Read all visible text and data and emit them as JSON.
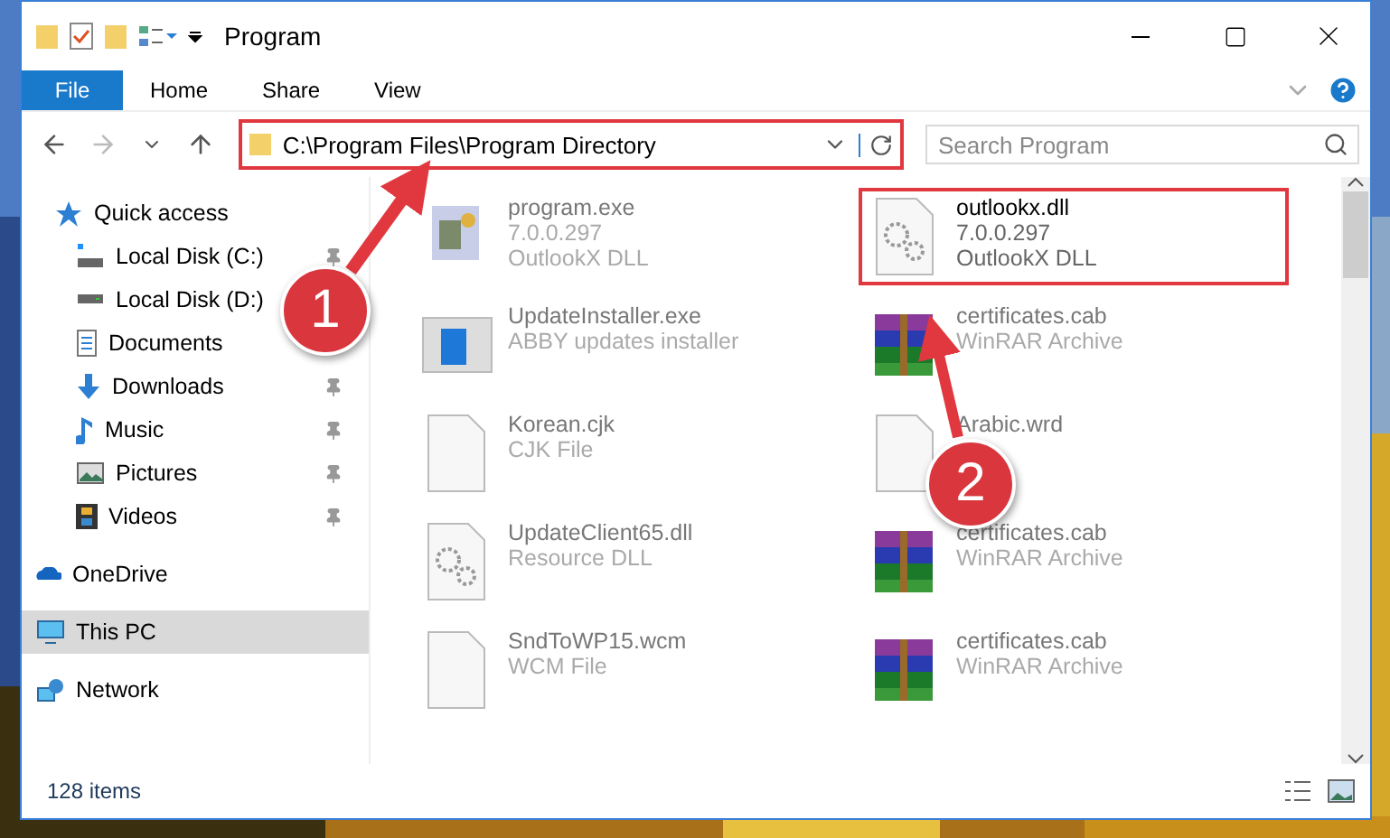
{
  "window": {
    "title": "Program"
  },
  "ribbon": {
    "tabs": [
      {
        "label": "File",
        "kind": "menu"
      },
      {
        "label": "Home",
        "kind": "tab"
      },
      {
        "label": "Share",
        "kind": "tab"
      },
      {
        "label": "View",
        "kind": "tab"
      }
    ]
  },
  "address_bar": {
    "path": "C:\\Program Files\\Program Directory",
    "highlighted": true
  },
  "search": {
    "placeholder": "Search Program"
  },
  "sidebar": {
    "items": [
      {
        "label": "Quick access",
        "selected": false,
        "children": [
          {
            "label": "Local Disk (C:)",
            "pinned": true
          },
          {
            "label": "Local Disk (D:)"
          },
          {
            "label": "Documents"
          },
          {
            "label": "Downloads",
            "pinned": true
          },
          {
            "label": "Music",
            "pinned": true
          },
          {
            "label": "Pictures",
            "pinned": true
          },
          {
            "label": "Videos",
            "pinned": true
          }
        ]
      },
      {
        "label": "OneDrive",
        "selected": false
      },
      {
        "label": "This PC",
        "selected": true
      },
      {
        "label": "Network",
        "selected": false
      }
    ]
  },
  "files": [
    {
      "name": "program.exe",
      "details": [
        "7.0.0.297",
        "OutlookX DLL"
      ],
      "kind": "application",
      "highlighted": false
    },
    {
      "name": "outlookx.dll",
      "details": [
        "7.0.0.297",
        "OutlookX DLL"
      ],
      "kind": "library",
      "highlighted": true
    },
    {
      "name": "UpdateInstaller.exe",
      "details": [
        "ABBY updates installer"
      ],
      "kind": "installer",
      "highlighted": false
    },
    {
      "name": "certificates.cab",
      "details": [
        "WinRAR Archive"
      ],
      "kind": "archive",
      "highlighted": false
    },
    {
      "name": "Korean.cjk",
      "details": [
        "CJK File"
      ],
      "kind": "document",
      "highlighted": false
    },
    {
      "name": "Arabic.wrd",
      "kind": "document",
      "highlighted": false
    },
    {
      "name": "UpdateClient65.dll",
      "details": [
        "Resource DLL"
      ],
      "kind": "library",
      "highlighted": false
    },
    {
      "name": "certificates.cab",
      "details": [
        "WinRAR Archive"
      ],
      "kind": "archive",
      "highlighted": false
    },
    {
      "name": "SndToWP15.wcm",
      "details": [
        "WCM File"
      ],
      "kind": "document",
      "highlighted": false
    },
    {
      "name": "certificates.cab",
      "details": [
        "WinRAR Archive"
      ],
      "kind": "archive",
      "highlighted": false
    }
  ],
  "status_bar": {
    "count": "128 items"
  },
  "annotations": [
    {
      "number": "1"
    },
    {
      "number": "2"
    }
  ]
}
